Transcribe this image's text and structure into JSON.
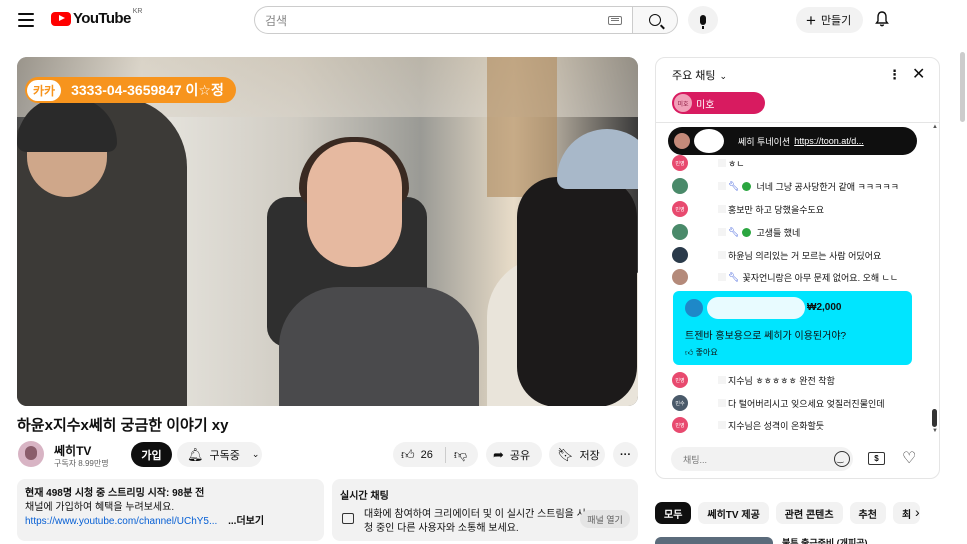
{
  "header": {
    "logo_text": "YouTube",
    "logo_region": "KR",
    "search_placeholder": "검색",
    "create_label": "만들기"
  },
  "video": {
    "overlay_tag": "카카",
    "overlay_text": "3333-04-3659847 이☆정",
    "title": "하윤x지수x쎄히 궁금한 이야기 xy"
  },
  "channel": {
    "name": "쎄히TV",
    "subscribers": "구독자 8.99만명",
    "join_label": "가입",
    "subscribed_label": "구독중"
  },
  "actions": {
    "likes": "26",
    "share_label": "공유",
    "save_label": "저장",
    "more_label": "···"
  },
  "description": {
    "meta": "현재 498명 시청 중  스트리밍 시작: 98분 전",
    "line1": "채널에 가입하여 혜택을 누려보세요.",
    "link": "https://www.youtube.com/channel/UChY5...",
    "more_label": "...더보기"
  },
  "live_chat_card": {
    "heading": "실시간 채팅",
    "body": "대화에 참여하여 크리에이터 및 이 실시간 스트림을 시청 중인 다른 사용자와 소통해 보세요.",
    "open_label": "패널 열기"
  },
  "chat": {
    "mode_label": "주요 채팅",
    "pinned_user": {
      "avatar_text": "미호",
      "name": "미호"
    },
    "ticker": {
      "name": "쎄히 투네이션",
      "link": "https://toon.at/d..."
    },
    "messages": [
      {
        "avatar_text": "민영",
        "avatar_color": "#e84a6f",
        "badges": "",
        "text": "ㅎㄴ"
      },
      {
        "avatar_text": "",
        "avatar_color": "#4a8a6a",
        "badges": "wrench-check",
        "text": "너네 그냥 공사당한거 같애 ㅋㅋㅋㅋㅋ"
      },
      {
        "avatar_text": "민영",
        "avatar_color": "#e84a6f",
        "badges": "",
        "text": "홍보만 하고 당했을수도요"
      },
      {
        "avatar_text": "",
        "avatar_color": "#4a8a6a",
        "badges": "wrench-check",
        "text": "고생들 했네"
      },
      {
        "avatar_text": "",
        "avatar_color": "#2a3a4a",
        "badges": "",
        "text": "하윤님 의리있는 거 모르는 사람 어딨어요"
      },
      {
        "avatar_text": "",
        "avatar_color": "#b48a7a",
        "badges": "wrench",
        "text": "꽃자언니랑은 아무 문제 없어요. 오해 ㄴㄴ"
      },
      {
        "avatar_text": "민영",
        "avatar_color": "#e84a6f",
        "badges": "",
        "text": "지수님 ㅎㅎㅎㅎㅎ 완전 착함"
      },
      {
        "avatar_text": "민수",
        "avatar_color": "#4a5a6a",
        "badges": "",
        "text": "다 털어버리시고 잊으세요 엊질러진물인데"
      },
      {
        "avatar_text": "민영",
        "avatar_color": "#e84a6f",
        "badges": "",
        "text": "지수님은 성격이 온화할듯"
      }
    ],
    "superchat": {
      "amount": "₩2,000",
      "text": "트젠바 홍보용으로 쎄히가 이용된거야?",
      "like_label": "좋아요"
    },
    "input_placeholder": "채팅..."
  },
  "chips": [
    "모두",
    "쎄히TV 제공",
    "관련 콘텐츠",
    "추천",
    "최"
  ],
  "next_video_title": "불투 출근준비 (개피곤)"
}
